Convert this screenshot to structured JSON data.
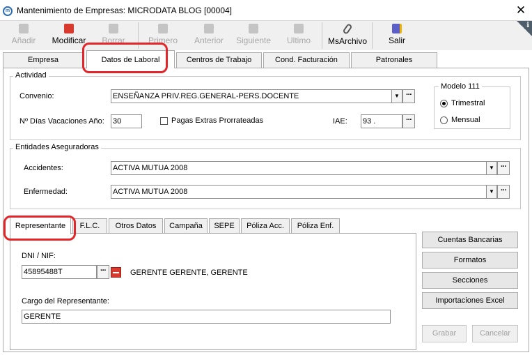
{
  "window": {
    "title": "Mantenimiento de Empresas: MICRODATA BLOG [00004]",
    "close_glyph": "✕",
    "app_icon_text": "m"
  },
  "toolbar": {
    "add": "Añadir",
    "modify": "Modificar",
    "delete": "Borrar",
    "first": "Primero",
    "previous": "Anterior",
    "next": "Siguiente",
    "last": "Ultimo",
    "msarchivo": "MsArchivo",
    "exit": "Salir",
    "info": "i"
  },
  "main_tabs": [
    {
      "label": "Empresa"
    },
    {
      "label": "Datos de Laboral"
    },
    {
      "label": "Centros de Trabajo"
    },
    {
      "label": "Cond. Facturación"
    },
    {
      "label": "Patronales"
    }
  ],
  "actividad": {
    "title": "Actividad",
    "convenio_label": "Convenio:",
    "convenio_value": "ENSEÑANZA PRIV.REG.GENERAL-PERS.DOCENTE",
    "vacaciones_label": "Nº Días Vacaciones Año:",
    "vacaciones_value": "30",
    "pagas_label": "Pagas Extras Prorrateadas",
    "iae_label": "IAE:",
    "iae_value": "93 ."
  },
  "modelo111": {
    "title": "Modelo 111",
    "trimestral": "Trimestral",
    "mensual": "Mensual"
  },
  "entidades": {
    "title": "Entidades Aseguradoras",
    "accidentes_label": "Accidentes:",
    "accidentes_value": "ACTIVA MUTUA 2008",
    "enfermedad_label": "Enfermedad:",
    "enfermedad_value": "ACTIVA MUTUA 2008"
  },
  "sub_tabs": [
    {
      "label": "Representante"
    },
    {
      "label": "F.L.C."
    },
    {
      "label": "Otros Datos"
    },
    {
      "label": "Campaña"
    },
    {
      "label": "SEPE"
    },
    {
      "label": "Póliza Acc."
    },
    {
      "label": "Póliza Enf."
    }
  ],
  "representante": {
    "dni_label": "DNI / NIF:",
    "dni_value": "45895488T",
    "name_value": "GERENTE GERENTE, GERENTE",
    "cargo_label": "Cargo del Representante:",
    "cargo_value": "GERENTE"
  },
  "side_buttons": {
    "cuentas": "Cuentas Bancarias",
    "formatos": "Formatos",
    "secciones": "Secciones",
    "importaciones": "Importaciones Excel"
  },
  "bottom_buttons": {
    "grabar": "Grabar",
    "cancelar": "Cancelar"
  },
  "colors": {
    "annotation": "#e3262a",
    "accent": "#2d6db3"
  },
  "glyphs": {
    "dropdown": "▼",
    "dots": "···"
  }
}
